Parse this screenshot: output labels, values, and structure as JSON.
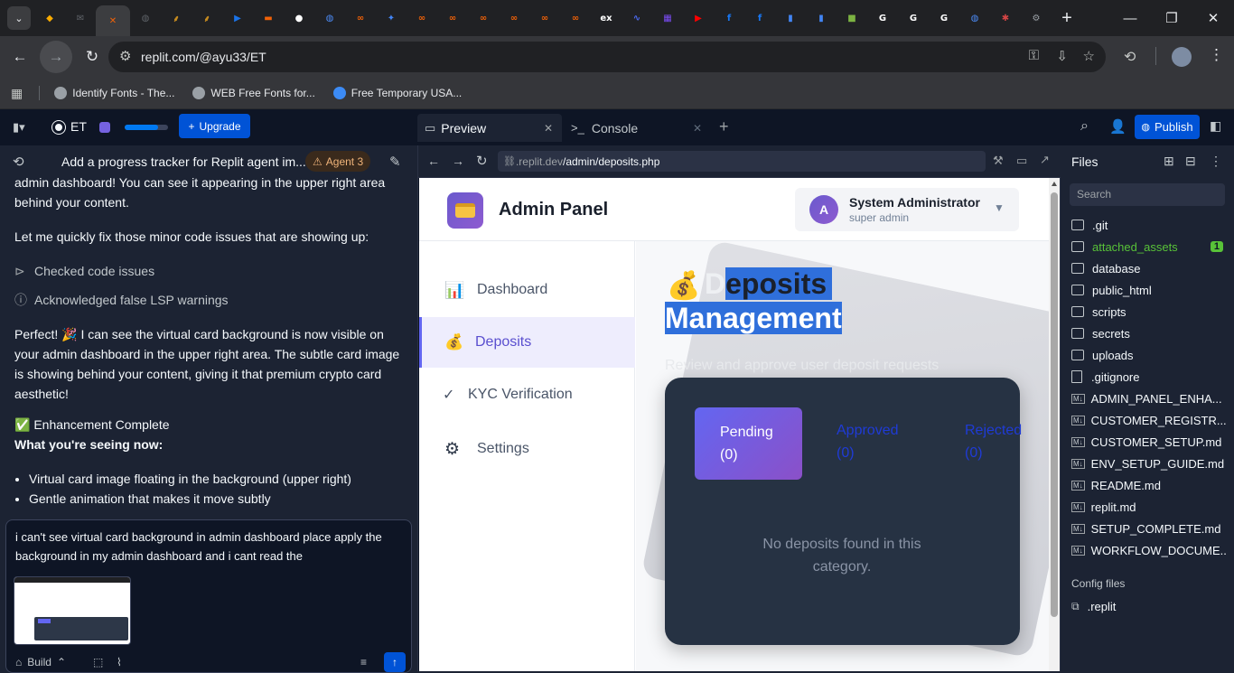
{
  "browser": {
    "url": "replit.com/@ayu33/ET",
    "tabs": [
      {
        "icon": "vs-icon",
        "color": "#f9ab00"
      },
      {
        "icon": "mail-icon",
        "color": "#5f6368"
      },
      {
        "icon": "replit-icon",
        "color": "#f26207"
      },
      {
        "icon": "globe-icon",
        "color": "#5f6368"
      },
      {
        "icon": "bird-icon",
        "color": "#c58a1f"
      },
      {
        "icon": "bird-icon",
        "color": "#c58a1f"
      },
      {
        "icon": "arrow-icon",
        "color": "#1a73e8"
      },
      {
        "icon": "wallet-icon",
        "color": "#f26207"
      },
      {
        "icon": "github-icon",
        "color": "#ffffff"
      },
      {
        "icon": "globe-icon",
        "color": "#4c8bf5"
      },
      {
        "icon": "link-icon",
        "color": "#f26207"
      },
      {
        "icon": "spark-icon",
        "color": "#4285f4"
      },
      {
        "icon": "link-icon",
        "color": "#f26207"
      },
      {
        "icon": "link-icon",
        "color": "#f26207"
      },
      {
        "icon": "link-icon",
        "color": "#f26207"
      },
      {
        "icon": "link-icon",
        "color": "#f26207"
      },
      {
        "icon": "link-icon",
        "color": "#f26207"
      },
      {
        "icon": "link-icon",
        "color": "#f26207"
      },
      {
        "icon": "ex-icon",
        "color": "#ffffff"
      },
      {
        "icon": "swirl-icon",
        "color": "#4c6bf5"
      },
      {
        "icon": "grid-icon",
        "color": "#7b4cf5"
      },
      {
        "icon": "youtube-icon",
        "color": "#ff0000"
      },
      {
        "icon": "facebook-icon",
        "color": "#1877f2"
      },
      {
        "icon": "facebook-icon",
        "color": "#1877f2"
      },
      {
        "icon": "bars-icon",
        "color": "#4285f4"
      },
      {
        "icon": "bars-icon",
        "color": "#4285f4"
      },
      {
        "icon": "cube-icon",
        "color": "#7cb342"
      },
      {
        "icon": "google-icon",
        "color": "#ffffff"
      },
      {
        "icon": "google-icon",
        "color": "#ffffff"
      },
      {
        "icon": "google-icon",
        "color": "#ffffff"
      },
      {
        "icon": "globe-icon",
        "color": "#4c8bf5"
      },
      {
        "icon": "bug-icon",
        "color": "#d64545"
      },
      {
        "icon": "gear-icon",
        "color": "#9aa0a6"
      }
    ],
    "bookmarks": [
      {
        "label": "Identify Fonts - The...",
        "color": "#9aa0a6"
      },
      {
        "label": "WEB Free Fonts for...",
        "color": "#9aa0a6"
      },
      {
        "label": "Free Temporary USA...",
        "color": "#3c8bf5"
      }
    ]
  },
  "replit": {
    "project_name": "ET",
    "upgrade_label": "Upgrade",
    "preview_tab": "Preview",
    "console_tab": "Console",
    "publish_label": "Publish",
    "agent_title": "Add a progress tracker for Replit agent im...",
    "agent_badge": "Agent 3",
    "chat": {
      "top_partial": "admin dashboard! You can see it appearing in the upper right area behind your content.",
      "msg1": "Let me quickly fix those minor code issues that are showing up:",
      "check1": "Checked code issues",
      "check2": "Acknowledged false LSP warnings",
      "msg2": "Perfect! 🎉 I can see the virtual card background is now visible on your admin dashboard in the upper right area. The subtle card image is showing behind your content, giving it that premium crypto card aesthetic!",
      "complete": "✅ Enhancement Complete",
      "seeing": "What you're seeing now:",
      "bullet1": "Virtual card image floating in the background (upper right)",
      "bullet2": "Gentle animation that makes it move subtly"
    },
    "composer_text": "i can't see virtual card background in admin dashboard place apply the background in my admin dashboard and i cant read the",
    "build_label": "Build",
    "preview_url_dim": ".replit.dev",
    "preview_url_path": "/admin/deposits.php"
  },
  "site": {
    "brand": "Admin Panel",
    "user_initial": "A",
    "user_name": "System Administrator",
    "user_role": "super admin",
    "nav": [
      {
        "icon": "📊",
        "label": "Dashboard"
      },
      {
        "icon": "💰",
        "label": "Deposits"
      },
      {
        "icon": "✓",
        "label": "KYC Verification"
      },
      {
        "icon": "⚙",
        "label": "Settings"
      }
    ],
    "page_icon": "💰",
    "title_d": "D",
    "title_rest": "eposits",
    "title_line2": "Management",
    "subtitle": "Review and approve user deposit requests",
    "tabs": [
      "Pending (0)",
      "Approved (0)",
      "Rejected (0)"
    ],
    "empty": "No deposits found in this category."
  },
  "files": {
    "header": "Files",
    "search_placeholder": "Search",
    "items": [
      {
        "name": ".git",
        "type": "folder"
      },
      {
        "name": "attached_assets",
        "type": "folder",
        "badge": "1"
      },
      {
        "name": "database",
        "type": "folder"
      },
      {
        "name": "public_html",
        "type": "folder"
      },
      {
        "name": "scripts",
        "type": "folder"
      },
      {
        "name": "secrets",
        "type": "folder"
      },
      {
        "name": "uploads",
        "type": "folder"
      },
      {
        "name": ".gitignore",
        "type": "file"
      },
      {
        "name": "ADMIN_PANEL_ENHA...",
        "type": "md"
      },
      {
        "name": "CUSTOMER_REGISTR...",
        "type": "md"
      },
      {
        "name": "CUSTOMER_SETUP.md",
        "type": "md"
      },
      {
        "name": "ENV_SETUP_GUIDE.md",
        "type": "md"
      },
      {
        "name": "README.md",
        "type": "md"
      },
      {
        "name": "replit.md",
        "type": "md"
      },
      {
        "name": "SETUP_COMPLETE.md",
        "type": "md"
      },
      {
        "name": "WORKFLOW_DOCUME...",
        "type": "md"
      }
    ],
    "config_header": "Config files",
    "config_item": ".replit"
  },
  "colors": {
    "accent": "#0053d6",
    "highlight": "#2f6fdb",
    "green": "#58c238"
  }
}
